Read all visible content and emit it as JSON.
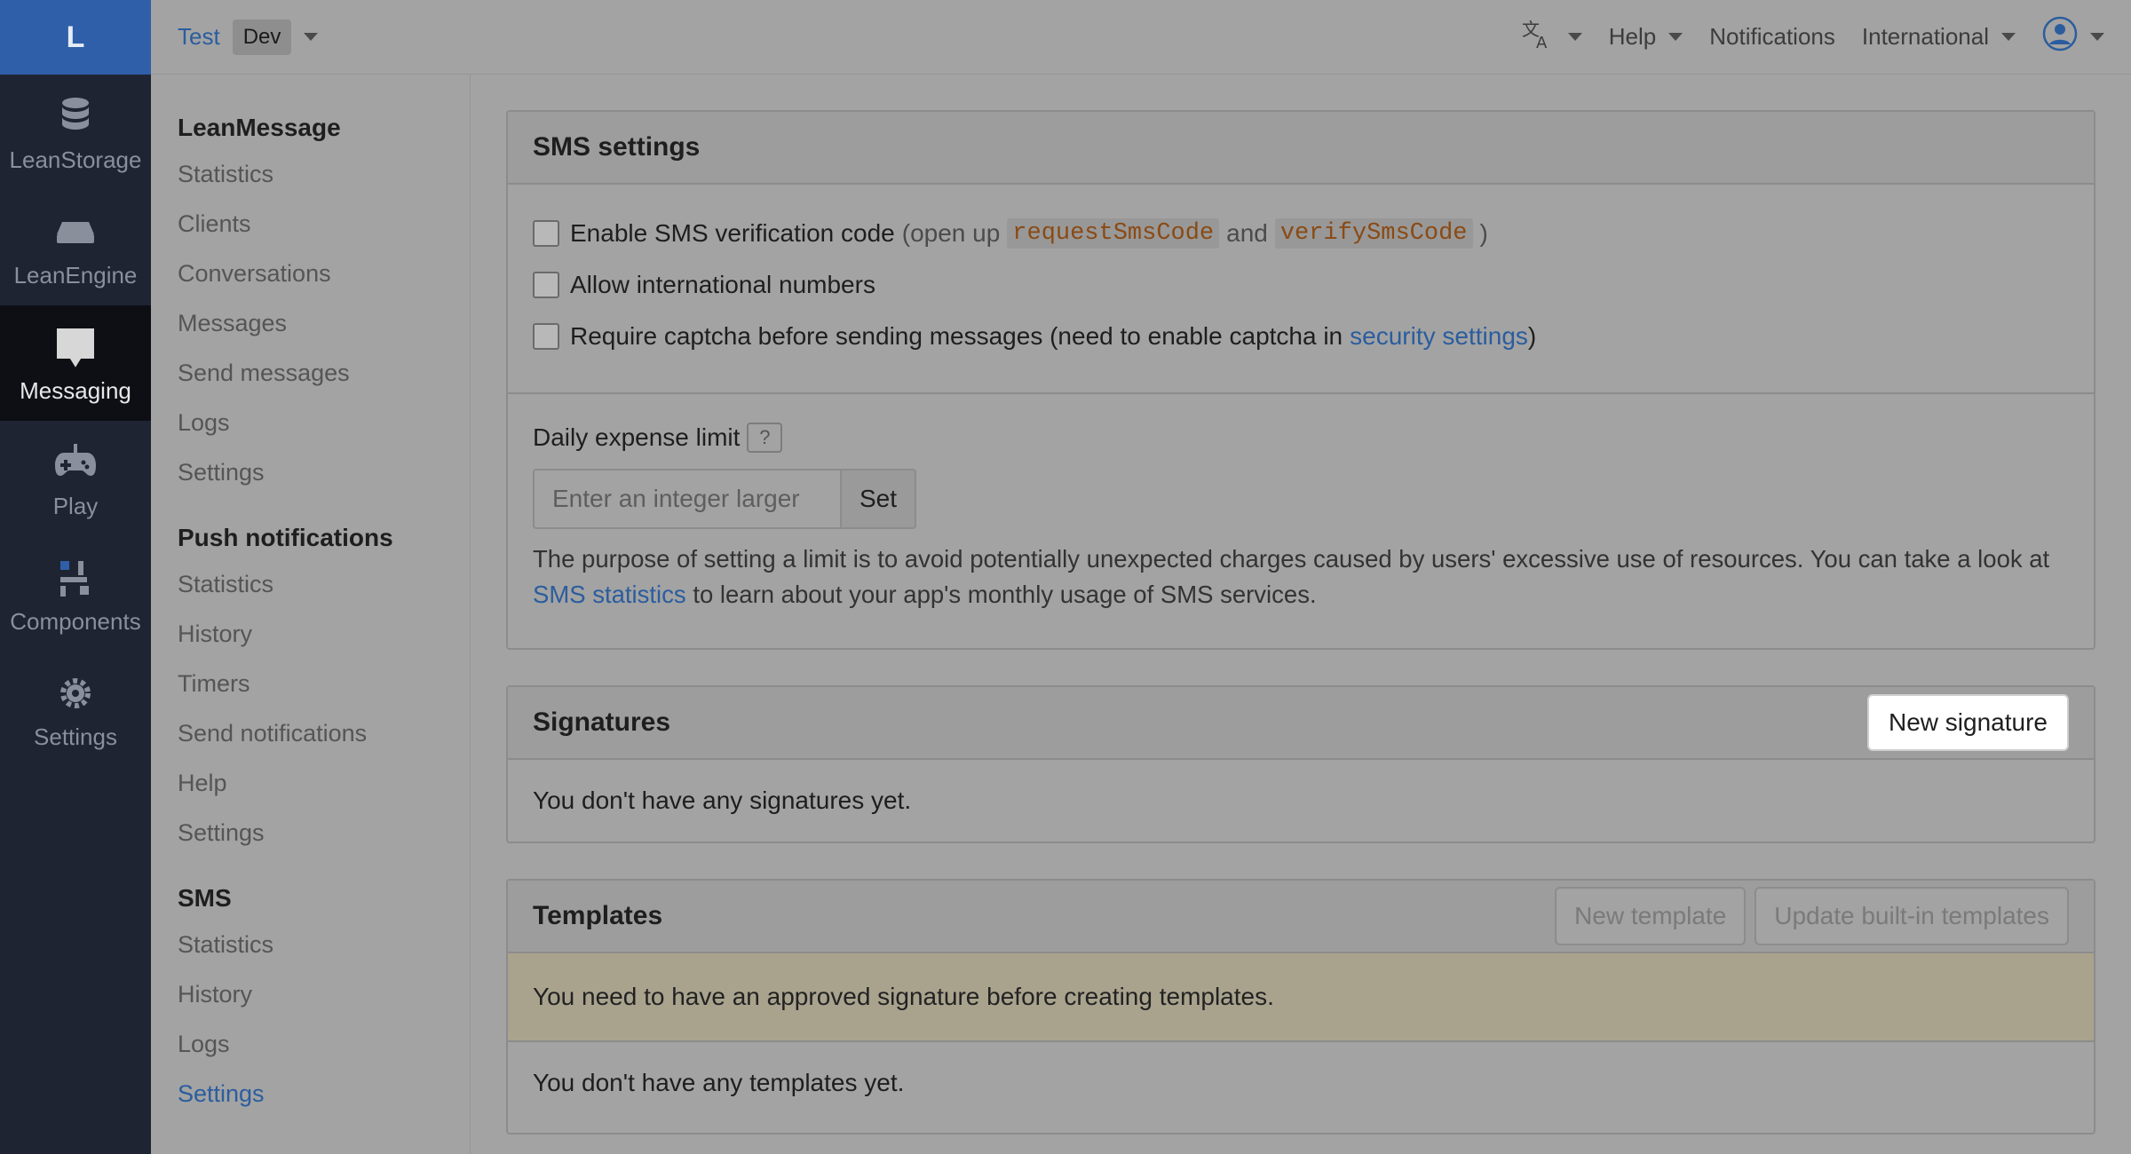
{
  "rail": {
    "logo": "L",
    "items": [
      {
        "label": "LeanStorage",
        "icon": "database-icon"
      },
      {
        "label": "LeanEngine",
        "icon": "server-icon"
      },
      {
        "label": "Messaging",
        "icon": "message-icon"
      },
      {
        "label": "Play",
        "icon": "gamepad-icon"
      },
      {
        "label": "Components",
        "icon": "components-icon"
      },
      {
        "label": "Settings",
        "icon": "gear-icon"
      }
    ],
    "active": "Messaging"
  },
  "topbar": {
    "app_name": "Test",
    "env": "Dev",
    "help": "Help",
    "notifications": "Notifications",
    "region": "International"
  },
  "subnav": {
    "sections": [
      {
        "title": "LeanMessage",
        "links": [
          "Statistics",
          "Clients",
          "Conversations",
          "Messages",
          "Send messages",
          "Logs",
          "Settings"
        ]
      },
      {
        "title": "Push notifications",
        "links": [
          "Statistics",
          "History",
          "Timers",
          "Send notifications",
          "Help",
          "Settings"
        ]
      },
      {
        "title": "SMS",
        "links": [
          "Statistics",
          "History",
          "Logs",
          "Settings"
        ]
      }
    ],
    "active_link": "SMS / Settings"
  },
  "sms_settings": {
    "title": "SMS settings",
    "opt1_label": "Enable SMS verification code",
    "opt1_hint_prefix": "(open up",
    "opt1_code1": "requestSmsCode",
    "opt1_hint_and": "and",
    "opt1_code2": "verifySmsCode",
    "opt1_hint_suffix": ")",
    "opt2_label": "Allow international numbers",
    "opt3_label": "Require captcha before sending messages (need to enable captcha in",
    "opt3_link": "security settings",
    "opt3_suffix": ")",
    "limit_label": "Daily expense limit",
    "limit_help": "?",
    "limit_placeholder": "Enter an integer larger",
    "limit_button": "Set",
    "desc_part1": "The purpose of setting a limit is to avoid potentially unexpected charges caused by users' excessive use of resources. You can take a look at",
    "desc_link": "SMS statistics",
    "desc_part2": "to learn about your app's monthly usage of SMS services."
  },
  "signatures": {
    "title": "Signatures",
    "new_button": "New signature",
    "empty": "You don't have any signatures yet."
  },
  "templates": {
    "title": "Templates",
    "new_button": "New template",
    "update_button": "Update built-in templates",
    "alert": "You need to have an approved signature before creating templates.",
    "empty": "You don't have any templates yet."
  }
}
